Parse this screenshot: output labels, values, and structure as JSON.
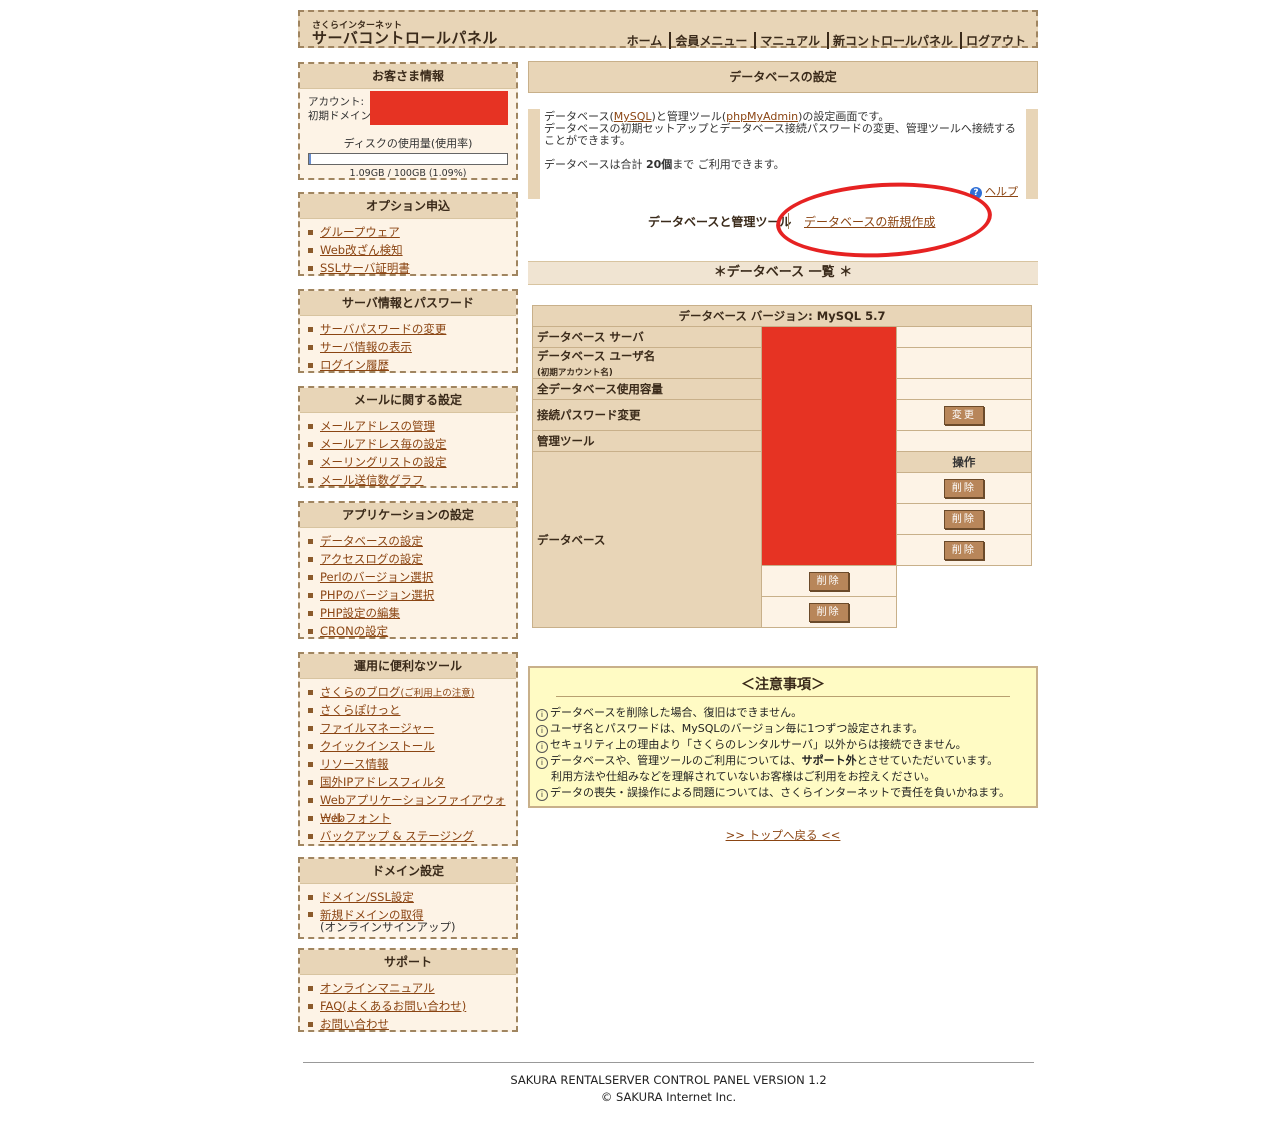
{
  "header": {
    "subtitle": "さくらインターネット",
    "title": "サーバコントロールパネル",
    "nav": [
      "ホーム",
      "会員メニュー",
      "マニュアル",
      "新コントロールパネル",
      "ログアウト"
    ]
  },
  "sidebar": {
    "customer": {
      "title": "お客さま情報",
      "account_label": "アカウント:",
      "domain_label": "初期ドメイン:",
      "disk_label": "ディスクの使用量(使用率)",
      "disk_value": "1.09GB / 100GB (1.09%)",
      "disk_fraction": 0.0109
    },
    "options": {
      "title": "オプション申込",
      "items": [
        "グループウェア",
        "Web改ざん検知",
        "SSLサーバ証明書"
      ]
    },
    "server": {
      "title": "サーバ情報とパスワード",
      "items": [
        "サーバパスワードの変更",
        "サーバ情報の表示",
        "ログイン履歴"
      ]
    },
    "mail": {
      "title": "メールに関する設定",
      "items": [
        "メールアドレスの管理",
        "メールアドレス毎の設定",
        "メーリングリストの設定",
        "メール送信数グラフ"
      ]
    },
    "apps": {
      "title": "アプリケーションの設定",
      "items": [
        "データベースの設定",
        "アクセスログの設定",
        "Perlのバージョン選択",
        "PHPのバージョン選択",
        "PHP設定の編集",
        "CRONの設定"
      ]
    },
    "tools": {
      "title": "運用に便利なツール",
      "items": [
        "さくらのブログ",
        "さくらぽけっと",
        "ファイルマネージャー",
        "クイックインストール",
        "リソース情報",
        "国外IPアドレスフィルタ",
        "Webアプリケーションファイアウォール",
        "Webフォント",
        "バックアップ & ステージング"
      ],
      "blog_note": "(ご利用上の注意)"
    },
    "domain": {
      "title": "ドメイン設定",
      "item1": "ドメイン/SSL設定",
      "item2a": "新規ドメインの取得",
      "item2b": "(オンラインサインアップ)"
    },
    "support": {
      "title": "サポート",
      "items": [
        "オンラインマニュアル",
        "FAQ(よくあるお問い合わせ)",
        "お問い合わせ"
      ]
    }
  },
  "main": {
    "page_title": "データベースの設定",
    "desc_l1a": "データベース(",
    "desc_link1": "MySQL",
    "desc_l1b": ")と管理ツール(",
    "desc_link2": "phpMyAdmin",
    "desc_l1c": ")の設定画面です。",
    "desc_l2": "データベースの初期セットアップとデータベース接続パスワードの変更、管理ツールへ接続することができます。",
    "desc_l3a": "データベースは合計 ",
    "desc_l3b": "20個",
    "desc_l3c": "まで ご利用できます。",
    "help": "ヘルプ",
    "help_icon": "?",
    "tab_active": "データベースと管理ツール",
    "tab_link": "データベースの新規作成",
    "list_title": "＊データベース 一覧 ＊",
    "table": {
      "caption": "データベース バージョン: MySQL 5.7",
      "row_server": "データベース サーバ",
      "row_user": "データベース ユーザ名",
      "row_user_note": "(初期アカウント名)",
      "row_usage": "全データベース使用容量",
      "row_password": "接続パスワード変更",
      "row_tool": "管理ツール",
      "row_db": "データベース",
      "op_header": "操作",
      "change_button": "変更",
      "delete_buttons": [
        "削除",
        "削除",
        "削除",
        "削除",
        "削除"
      ]
    },
    "notice": {
      "title": "＜注意事項＞",
      "l1": "データベースを削除した場合、復旧はできません。",
      "l2": "ユーザ名とパスワードは、MySQLのバージョン毎に1つずつ設定されます。",
      "l3": "セキュリティ上の理由より「さくらのレンタルサーバ」以外からは接続できません。",
      "l4a": "データベースや、管理ツールのご利用については、",
      "l4b": "サポート外",
      "l4c": "とさせていただいています。",
      "l4d": "利用方法や仕組みなどを理解されていないお客様はご利用をお控えください。",
      "l5": "データの喪失・誤操作による問題については、さくらインターネットで責任を負いかねます。"
    },
    "back_link": ">> トップへ戻る <<"
  },
  "footer": {
    "line1": "SAKURA RENTALSERVER CONTROL PANEL VERSION 1.2",
    "line2": "© SAKURA Internet Inc."
  },
  "colors": {
    "accent": "#e8d5b7",
    "redaction": "#e63323",
    "notice_bg": "#fffbc4",
    "link": "#8b4513",
    "annotation_circle": "#e62222"
  }
}
